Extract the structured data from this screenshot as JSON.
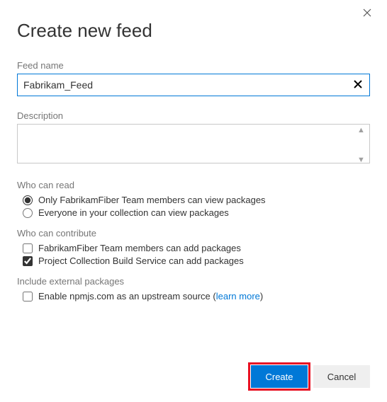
{
  "title": "Create new feed",
  "feedName": {
    "label": "Feed name",
    "value": "Fabrikam_Feed"
  },
  "description": {
    "label": "Description",
    "value": ""
  },
  "whoCanRead": {
    "label": "Who can read",
    "options": [
      {
        "label": "Only FabrikamFiber Team members can view packages",
        "checked": true
      },
      {
        "label": "Everyone in your collection can view packages",
        "checked": false
      }
    ]
  },
  "whoCanContribute": {
    "label": "Who can contribute",
    "options": [
      {
        "label": "FabrikamFiber Team members can add packages",
        "checked": false
      },
      {
        "label": "Project Collection Build Service can add packages",
        "checked": true
      }
    ]
  },
  "external": {
    "label": "Include external packages",
    "option_prefix": "Enable npmjs.com as an upstream source (",
    "link_text": "learn more",
    "option_suffix": ")",
    "checked": false
  },
  "buttons": {
    "create": "Create",
    "cancel": "Cancel"
  }
}
